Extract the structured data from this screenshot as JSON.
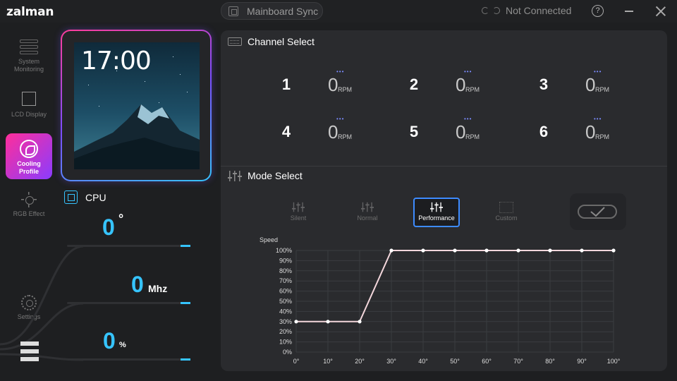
{
  "app": {
    "brand": "zalman",
    "mainboard_sync": "Mainboard Sync",
    "connection_status": "Not Connected",
    "help": "?"
  },
  "sidebar": {
    "items": [
      {
        "label": "System Monitoring",
        "icon": "system-monitoring-icon"
      },
      {
        "label": "LCD Display",
        "icon": "lcd-display-icon"
      },
      {
        "label": "Cooling Profile",
        "icon": "cooling-profile-icon",
        "active": true
      },
      {
        "label": "RGB Effect",
        "icon": "rgb-effect-icon"
      },
      {
        "label": "Settings",
        "icon": "settings-icon"
      }
    ]
  },
  "lcd": {
    "time": "17:00"
  },
  "cpu": {
    "label": "CPU",
    "temp": {
      "value": "0",
      "unit": "°"
    },
    "clock": {
      "value": "0",
      "unit": "Mhz"
    },
    "load": {
      "value": "0",
      "unit": "%"
    }
  },
  "channel_select": {
    "title": "Channel Select",
    "channels": [
      {
        "num": "1",
        "rpm": "0",
        "unit": "RPM"
      },
      {
        "num": "2",
        "rpm": "0",
        "unit": "RPM"
      },
      {
        "num": "3",
        "rpm": "0",
        "unit": "RPM"
      },
      {
        "num": "4",
        "rpm": "0",
        "unit": "RPM"
      },
      {
        "num": "5",
        "rpm": "0",
        "unit": "RPM"
      },
      {
        "num": "6",
        "rpm": "0",
        "unit": "RPM"
      }
    ]
  },
  "mode_select": {
    "title": "Mode Select",
    "modes": [
      {
        "label": "Silent"
      },
      {
        "label": "Normal"
      },
      {
        "label": "Performance",
        "active": true
      },
      {
        "label": "Custom"
      }
    ]
  },
  "colors": {
    "accent": "#36c4ff",
    "active_mode": "#3d8bff",
    "curve": "#f4d7dc"
  },
  "chart_data": {
    "type": "line",
    "ylabel": "Speed",
    "x": [
      0,
      10,
      20,
      30,
      40,
      50,
      60,
      70,
      80,
      90,
      100
    ],
    "x_tick_labels": [
      "0°",
      "10°",
      "20°",
      "30°",
      "40°",
      "50°",
      "60°",
      "70°",
      "80°",
      "90°",
      "100°"
    ],
    "y_tick_labels": [
      "0%",
      "10%",
      "20%",
      "30%",
      "40%",
      "50%",
      "60%",
      "70%",
      "80%",
      "90%",
      "100%"
    ],
    "ylim": [
      0,
      100
    ],
    "xlim": [
      0,
      100
    ],
    "grid": true,
    "series": [
      {
        "values": [
          30,
          30,
          30,
          100,
          100,
          100,
          100,
          100,
          100,
          100,
          100
        ]
      }
    ]
  }
}
